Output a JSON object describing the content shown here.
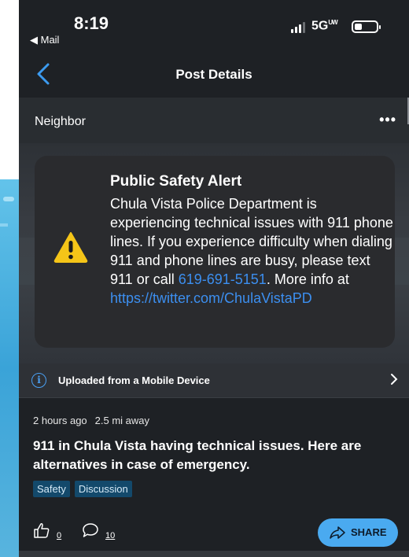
{
  "status_bar": {
    "time": "8:19",
    "back_app": "◀ Mail",
    "network": "5G",
    "network_suffix": "UW"
  },
  "nav": {
    "title": "Post Details"
  },
  "post": {
    "author": "Neighbor",
    "more_label": "•••",
    "alert": {
      "title": "Public Safety Alert",
      "body_text": "Chula Vista Police Department is experiencing technical issues with 911 phone lines. If you experience difficulty when dialing 911 and phone lines are busy, please text 911 or call ",
      "phone": "619-691-5151",
      "more_text": ". More info at ",
      "link": "https://twitter.com/ChulaVistaPD"
    },
    "uploaded_label": "Uploaded from a Mobile Device",
    "time_ago": "2 hours ago",
    "distance": "2.5 mi away",
    "headline": "911 in Chula Vista having technical issues. Here are alternatives in case of emergency.",
    "tags": [
      "Safety",
      "Discussion"
    ],
    "likes": "0",
    "comments": "10",
    "share_label": "SHARE"
  },
  "colors": {
    "background": "#1e2125",
    "accent": "#4aaaf0",
    "link": "#3c8ff0",
    "tag_bg": "#13496b",
    "warning": "#f5c518"
  },
  "icons": [
    "back-chevron-icon",
    "more-dots-icon",
    "warning-icon",
    "info-icon",
    "chevron-right-icon",
    "thumbs-up-icon",
    "comment-icon",
    "share-arrow-icon"
  ]
}
